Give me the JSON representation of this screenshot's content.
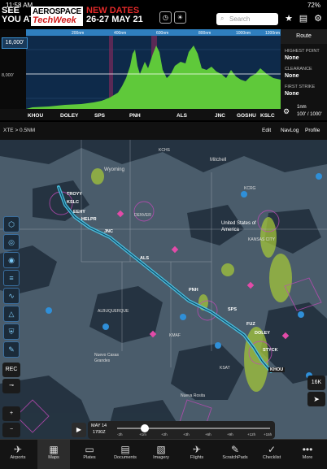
{
  "status": {
    "time": "11:58 AM",
    "right": "72%"
  },
  "ad": {
    "word1": "SEE",
    "word2": "YOU AT",
    "brand1": "AEROSPACE",
    "brand2": "TechWeek",
    "line1": "NEW DATES",
    "line2": "26-27 MAY 21"
  },
  "search": {
    "placeholder": "Search"
  },
  "profile": {
    "altitude": "16,000'",
    "alt_label": "8,000'",
    "distance_ticks": [
      "200nm",
      "400nm",
      "600nm",
      "800nm",
      "1000nm",
      "1200nm"
    ],
    "airports": [
      "KHOU",
      "DOLEY",
      "SPS",
      "PNH",
      "ALS",
      "JNC",
      "GOSHU",
      "KSLC"
    ]
  },
  "route_panel": {
    "title": "Route",
    "highest_label": "HIGHEST POINT",
    "highest_value": "None",
    "clearance_label": "CLEARANCE",
    "clearance_value": "None",
    "strike_label": "FIRST STRIKE",
    "strike_value": "None",
    "scale": "1nm",
    "range": "100' / 1000'"
  },
  "toolbar2": {
    "xte": "XTE > 0.5NM",
    "edit": "Edit",
    "navlog": "NavLog",
    "profile": "Profile"
  },
  "map": {
    "waypoints": [
      "KHOU",
      "STYCK",
      "DOLEY",
      "FUZ",
      "SPS",
      "PNH",
      "ALS",
      "JNC",
      "HELPR",
      "EEHY",
      "KSLC",
      "TROYY"
    ],
    "map_labels": [
      "Wyoming",
      "Mitchell",
      "United States of America",
      "KANSAS CITY",
      "DENVER",
      "ALBUQUERQUE",
      "Nueva Rosita",
      "Nuevo Casas Grandes",
      "KCHS",
      "KSAT",
      "KCRG",
      "KMAF"
    ],
    "rec_label": "REC",
    "alt_btn": "16K",
    "time_label_1": "MAY 14",
    "time_label_2": "1700Z",
    "time_ticks": [
      "-2h",
      "+1m",
      "+2h",
      "+3h",
      "+6h",
      "+9h",
      "+12h",
      "+15h"
    ]
  },
  "tabs": [
    {
      "label": "Airports",
      "icon": "airport-icon"
    },
    {
      "label": "Maps",
      "icon": "map-icon"
    },
    {
      "label": "Plates",
      "icon": "plates-icon"
    },
    {
      "label": "Documents",
      "icon": "documents-icon"
    },
    {
      "label": "Imagery",
      "icon": "imagery-icon"
    },
    {
      "label": "Flights",
      "icon": "flights-icon"
    },
    {
      "label": "ScratchPads",
      "icon": "scratchpad-icon"
    },
    {
      "label": "Checklist",
      "icon": "checklist-icon"
    },
    {
      "label": "More",
      "icon": "more-icon"
    }
  ],
  "colors": {
    "accent": "#3ea8f0",
    "route": "#45c8e6",
    "terrain": "#5fc93a"
  }
}
